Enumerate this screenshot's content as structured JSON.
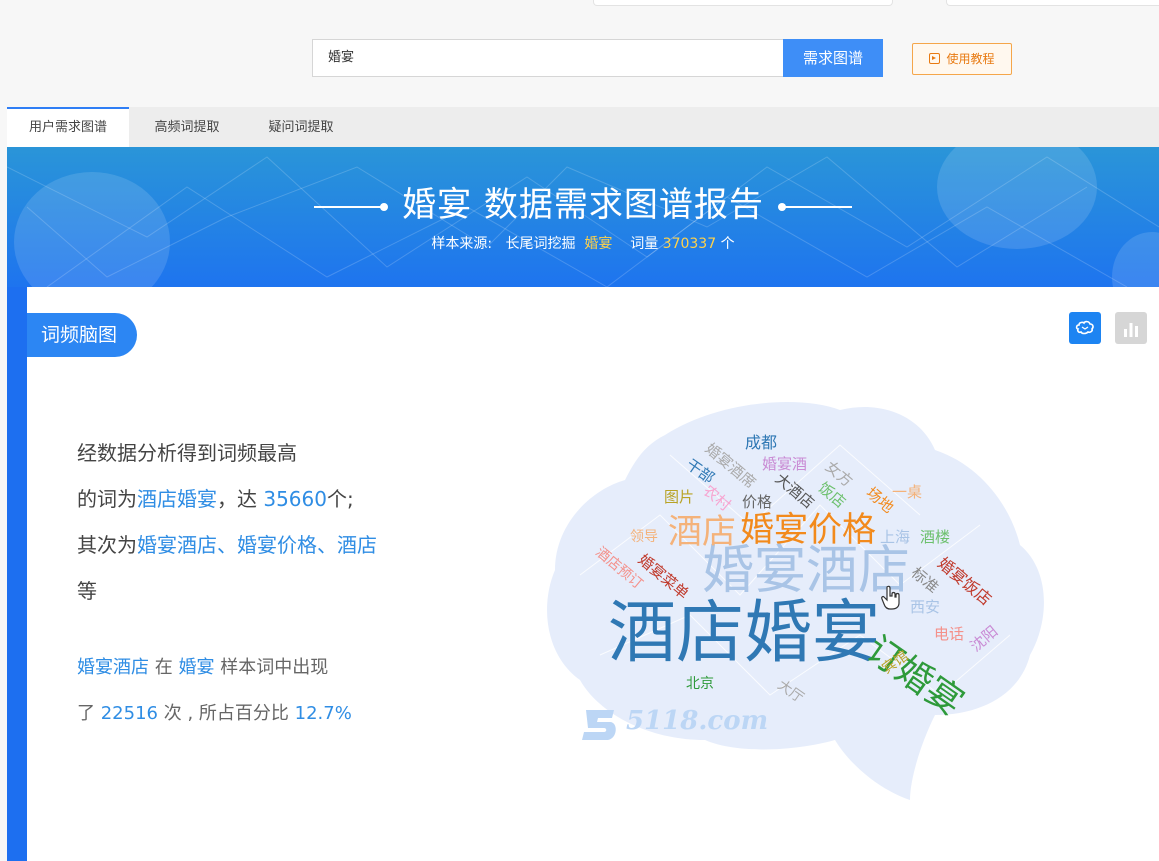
{
  "search": {
    "query": "婚宴",
    "button_label": "需求图谱",
    "tutorial_label": "使用教程"
  },
  "tabs": [
    {
      "label": "用户需求图谱",
      "active": true
    },
    {
      "label": "高频词提取",
      "active": false
    },
    {
      "label": "疑问词提取",
      "active": false
    }
  ],
  "banner": {
    "title": "婚宴 数据需求图谱报告",
    "sub_prefix": "样本来源:",
    "sub_source": "长尾词挖掘",
    "sub_keyword": "婚宴",
    "sub_count_label": "词量",
    "sub_count": "370337",
    "sub_unit": "个"
  },
  "section": {
    "title": "词频脑图"
  },
  "summary": {
    "line1": "经数据分析得到词频最高",
    "line2_prefix": "的词为",
    "top_word": "酒店婚宴",
    "line2_mid": "，达",
    "top_count": "35660",
    "line2_suffix": "个;",
    "line3_prefix": "其次为",
    "next_words": "婚宴酒店、婚宴价格、酒店",
    "line4": "等"
  },
  "detail": {
    "word": "婚宴酒店",
    "mid1": "在",
    "keyword": "婚宴",
    "mid2": "样本词中出现",
    "line2_prefix": "了",
    "times": "22516",
    "line2_mid": "次 , 所占百分比",
    "percent": "12.7%"
  },
  "word_cloud": [
    {
      "text": "酒店婚宴",
      "color": "#2f78b4"
    },
    {
      "text": "婚宴酒店",
      "color": "#a9c4e6"
    },
    {
      "text": "婚宴价格",
      "color": "#f28a1c"
    },
    {
      "text": "酒店",
      "color": "#f4b27a"
    },
    {
      "text": "订婚宴",
      "color": "#2e9a3a"
    },
    {
      "text": "成都",
      "color": "#2f78b4"
    },
    {
      "text": "婚宴酒",
      "color": "#c98bd4"
    },
    {
      "text": "干部",
      "color": "#2f78b4"
    },
    {
      "text": "婚宴酒席",
      "color": "#aaaaaa"
    },
    {
      "text": "大酒店",
      "color": "#555555"
    },
    {
      "text": "女方",
      "color": "#aaaaaa"
    },
    {
      "text": "饭店",
      "color": "#6cc06c"
    },
    {
      "text": "场地",
      "color": "#f28a1c"
    },
    {
      "text": "一桌",
      "color": "#f4b27a"
    },
    {
      "text": "图片",
      "color": "#b8a326"
    },
    {
      "text": "农村",
      "color": "#f7a4d0"
    },
    {
      "text": "价格",
      "color": "#666666"
    },
    {
      "text": "领导",
      "color": "#f4b27a"
    },
    {
      "text": "上海",
      "color": "#a9c4e6"
    },
    {
      "text": "酒楼",
      "color": "#6cc06c"
    },
    {
      "text": "酒店预订",
      "color": "#f4908a"
    },
    {
      "text": "婚宴菜单",
      "color": "#c0392b"
    },
    {
      "text": "标准",
      "color": "#888888"
    },
    {
      "text": "婚宴饭店",
      "color": "#c0392b"
    },
    {
      "text": "西安",
      "color": "#a9c4e6"
    },
    {
      "text": "电话",
      "color": "#f4908a"
    },
    {
      "text": "沈阳",
      "color": "#c98bd4"
    },
    {
      "text": "宾馆",
      "color": "#b8a326"
    },
    {
      "text": "北京",
      "color": "#2e9a3a"
    },
    {
      "text": "大厅",
      "color": "#aaaaaa"
    }
  ],
  "watermark": "5118.com"
}
